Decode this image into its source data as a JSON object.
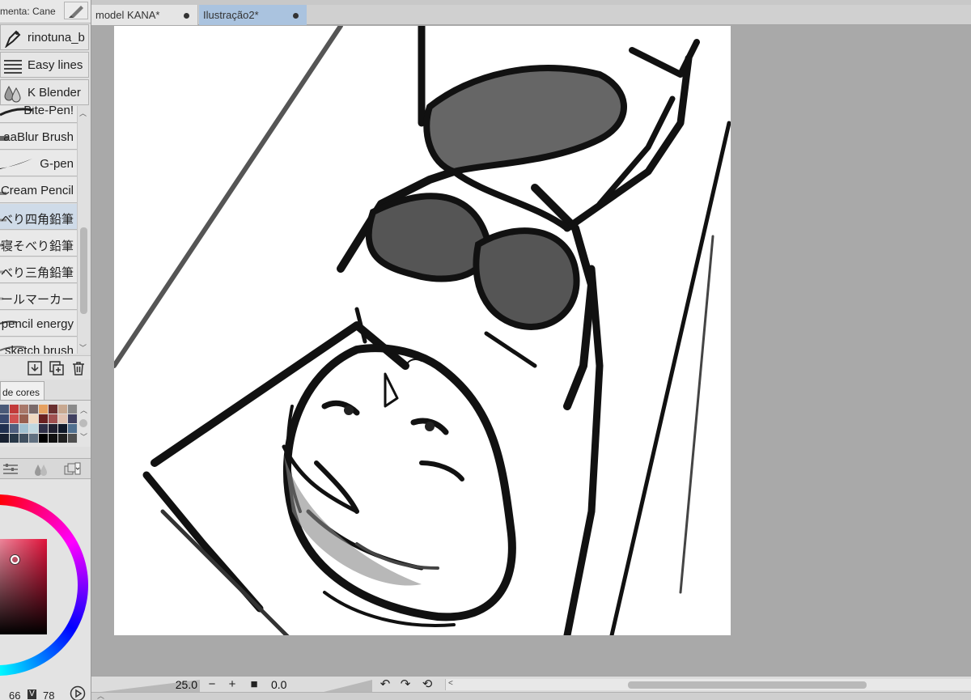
{
  "tool_panel": {
    "title": "menta: Cane",
    "big_brushes": [
      {
        "label": "rinotuna_b",
        "icon": "pen-nib-icon"
      },
      {
        "label": "Easy lines",
        "icon": "lines-icon"
      },
      {
        "label": "K Blender",
        "icon": "drops-icon"
      }
    ],
    "brushes": [
      {
        "label": "Bite-Pen!"
      },
      {
        "label": "aaBlur Brush"
      },
      {
        "label": "G-pen"
      },
      {
        "label": "Cream Pencil"
      },
      {
        "label": "べり四角鉛筆"
      },
      {
        "label": "寝そべり鉛筆"
      },
      {
        "label": "べり三角鉛筆"
      },
      {
        "label": "コールマーカー"
      },
      {
        "label": "pencil energy"
      },
      {
        "label": "sketch brush"
      }
    ],
    "selected_brush_index": 4
  },
  "swatch_panel": {
    "tab_label": "de cores",
    "colors": [
      "#4a5a78",
      "#c23a3a",
      "#a8786a",
      "#7a6a6a",
      "#e6a060",
      "#6a3030",
      "#c8a890",
      "#8a8a8a",
      "#3a4a70",
      "#d05050",
      "#986050",
      "#f0d8c0",
      "#6a2020",
      "#a05050",
      "#e0c0b0",
      "#404060",
      "#203050",
      "#506080",
      "#a0c0d0",
      "#c0d8e0",
      "#303048",
      "#202030",
      "#101828",
      "#507090",
      "#182030",
      "#283848",
      "#405060",
      "#607080",
      "#000000",
      "#101010",
      "#202020",
      "#505050"
    ]
  },
  "color_panel": {
    "hsv_value_1": "66",
    "hsv_label": "V",
    "hsv_value_2": "78",
    "main_color": "#e0133b"
  },
  "tabs": [
    {
      "label": "model KANA*"
    },
    {
      "label": "Ilustração2*"
    }
  ],
  "status": {
    "zoom": "25.0",
    "rotation": "0.0"
  }
}
